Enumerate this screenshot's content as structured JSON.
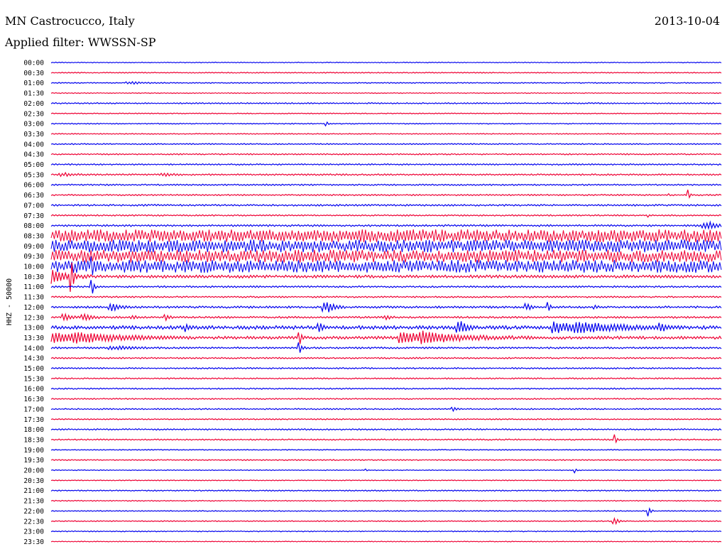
{
  "header": {
    "station": "MN Castrocucco, Italy",
    "date": "2013-10-04",
    "filter": "Applied filter: WWSSN-SP"
  },
  "chart_data": {
    "type": "line",
    "title": "MN Castrocucco, Italy",
    "ylabel": "HHZ - 50000",
    "traces": [
      {
        "label": "00:00",
        "color": "#0000ee",
        "noise": 0.6,
        "events": []
      },
      {
        "label": "00:30",
        "color": "#ee0033",
        "noise": 0.7,
        "events": []
      },
      {
        "label": "01:00",
        "color": "#0000ee",
        "noise": 0.7,
        "events": [
          {
            "t": 0.12,
            "amp": 1.5,
            "dur": 0.03
          }
        ]
      },
      {
        "label": "01:30",
        "color": "#ee0033",
        "noise": 0.6,
        "events": []
      },
      {
        "label": "02:00",
        "color": "#0000ee",
        "noise": 0.9,
        "events": []
      },
      {
        "label": "02:30",
        "color": "#ee0033",
        "noise": 0.6,
        "events": []
      },
      {
        "label": "03:00",
        "color": "#0000ee",
        "noise": 0.7,
        "events": [
          {
            "t": 0.41,
            "amp": 4,
            "dur": 0.004
          }
        ]
      },
      {
        "label": "03:30",
        "color": "#ee0033",
        "noise": 0.7,
        "events": []
      },
      {
        "label": "04:00",
        "color": "#0000ee",
        "noise": 0.8,
        "events": []
      },
      {
        "label": "04:30",
        "color": "#ee0033",
        "noise": 0.9,
        "events": []
      },
      {
        "label": "05:00",
        "color": "#0000ee",
        "noise": 1.0,
        "events": []
      },
      {
        "label": "05:30",
        "color": "#ee0033",
        "noise": 1.1,
        "events": [
          {
            "t": 0.02,
            "amp": 2,
            "dur": 0.03
          },
          {
            "t": 0.17,
            "amp": 2,
            "dur": 0.02
          }
        ]
      },
      {
        "label": "06:00",
        "color": "#0000ee",
        "noise": 1.0,
        "events": []
      },
      {
        "label": "06:30",
        "color": "#ee0033",
        "noise": 1.0,
        "events": [
          {
            "t": 0.95,
            "amp": 10,
            "dur": 0.004
          },
          {
            "t": 0.92,
            "amp": 3,
            "dur": 0.003
          }
        ]
      },
      {
        "label": "07:00",
        "color": "#0000ee",
        "noise": 1.2,
        "events": []
      },
      {
        "label": "07:30",
        "color": "#ee0033",
        "noise": 1.0,
        "events": [
          {
            "t": 0.89,
            "amp": 4,
            "dur": 0.003
          }
        ]
      },
      {
        "label": "08:00",
        "color": "#0000ee",
        "noise": 1.3,
        "events": [
          {
            "t": 0.98,
            "amp": 5,
            "dur": 0.03
          }
        ]
      },
      {
        "label": "08:30",
        "color": "#ee0033",
        "noise": 9,
        "events": []
      },
      {
        "label": "09:00",
        "color": "#0000ee",
        "noise": 9,
        "events": []
      },
      {
        "label": "09:30",
        "color": "#ee0033",
        "noise": 9,
        "events": []
      },
      {
        "label": "10:00",
        "color": "#0000ee",
        "noise": 9,
        "events": [
          {
            "t": 0.06,
            "amp": 22,
            "dur": 0.005
          }
        ]
      },
      {
        "label": "10:30",
        "color": "#ee0033",
        "noise": 2,
        "events": [
          {
            "t": 0.0,
            "amp": 10,
            "dur": 0.04
          },
          {
            "t": 0.03,
            "amp": 25,
            "dur": 0.006
          }
        ]
      },
      {
        "label": "11:00",
        "color": "#0000ee",
        "noise": 1.2,
        "events": [
          {
            "t": 0.06,
            "amp": 20,
            "dur": 0.005
          }
        ]
      },
      {
        "label": "11:30",
        "color": "#ee0033",
        "noise": 1.1,
        "events": []
      },
      {
        "label": "12:00",
        "color": "#0000ee",
        "noise": 1.4,
        "events": [
          {
            "t": 0.09,
            "amp": 6,
            "dur": 0.02
          },
          {
            "t": 0.41,
            "amp": 10,
            "dur": 0.02
          },
          {
            "t": 0.71,
            "amp": 5,
            "dur": 0.01
          },
          {
            "t": 0.74,
            "amp": 12,
            "dur": 0.006
          },
          {
            "t": 0.81,
            "amp": 5,
            "dur": 0.006
          }
        ]
      },
      {
        "label": "12:30",
        "color": "#ee0033",
        "noise": 1.3,
        "events": [
          {
            "t": 0.02,
            "amp": 5,
            "dur": 0.015
          },
          {
            "t": 0.05,
            "amp": 5,
            "dur": 0.02
          },
          {
            "t": 0.17,
            "amp": 5,
            "dur": 0.01
          },
          {
            "t": 0.12,
            "amp": 3,
            "dur": 0.01
          },
          {
            "t": 0.5,
            "amp": 3,
            "dur": 0.01
          }
        ]
      },
      {
        "label": "13:00",
        "color": "#0000ee",
        "noise": 2.5,
        "events": [
          {
            "t": 0.2,
            "amp": 6,
            "dur": 0.005
          },
          {
            "t": 0.4,
            "amp": 6,
            "dur": 0.01
          },
          {
            "t": 0.61,
            "amp": 9,
            "dur": 0.02
          },
          {
            "t": 0.78,
            "amp": 8,
            "dur": 0.11
          },
          {
            "t": 0.91,
            "amp": 6,
            "dur": 0.01
          }
        ]
      },
      {
        "label": "13:30",
        "color": "#ee0033",
        "noise": 2,
        "events": [
          {
            "t": 0.03,
            "amp": 8,
            "dur": 0.12
          },
          {
            "t": 0.37,
            "amp": 14,
            "dur": 0.006
          },
          {
            "t": 0.55,
            "amp": 9,
            "dur": 0.11
          }
        ]
      },
      {
        "label": "14:00",
        "color": "#0000ee",
        "noise": 1.2,
        "events": [
          {
            "t": 0.37,
            "amp": 10,
            "dur": 0.006
          },
          {
            "t": 0.1,
            "amp": 2,
            "dur": 0.05
          }
        ]
      },
      {
        "label": "14:30",
        "color": "#ee0033",
        "noise": 1.0,
        "events": []
      },
      {
        "label": "15:00",
        "color": "#0000ee",
        "noise": 1.0,
        "events": []
      },
      {
        "label": "15:30",
        "color": "#ee0033",
        "noise": 0.9,
        "events": []
      },
      {
        "label": "16:00",
        "color": "#0000ee",
        "noise": 0.9,
        "events": []
      },
      {
        "label": "16:30",
        "color": "#ee0033",
        "noise": 0.9,
        "events": []
      },
      {
        "label": "17:00",
        "color": "#0000ee",
        "noise": 0.9,
        "events": [
          {
            "t": 0.6,
            "amp": 3,
            "dur": 0.01
          }
        ]
      },
      {
        "label": "17:30",
        "color": "#ee0033",
        "noise": 0.8,
        "events": []
      },
      {
        "label": "18:00",
        "color": "#0000ee",
        "noise": 1.0,
        "events": []
      },
      {
        "label": "18:30",
        "color": "#ee0033",
        "noise": 0.9,
        "events": [
          {
            "t": 0.84,
            "amp": 8,
            "dur": 0.006
          }
        ]
      },
      {
        "label": "19:00",
        "color": "#0000ee",
        "noise": 0.6,
        "events": []
      },
      {
        "label": "19:30",
        "color": "#ee0033",
        "noise": 0.8,
        "events": []
      },
      {
        "label": "20:00",
        "color": "#0000ee",
        "noise": 0.6,
        "events": [
          {
            "t": 0.78,
            "amp": 7,
            "dur": 0.004
          },
          {
            "t": 0.47,
            "amp": 2,
            "dur": 0.004
          }
        ]
      },
      {
        "label": "20:30",
        "color": "#ee0033",
        "noise": 0.6,
        "events": []
      },
      {
        "label": "21:00",
        "color": "#0000ee",
        "noise": 0.8,
        "events": []
      },
      {
        "label": "21:30",
        "color": "#ee0033",
        "noise": 0.7,
        "events": []
      },
      {
        "label": "22:00",
        "color": "#0000ee",
        "noise": 0.7,
        "events": [
          {
            "t": 0.89,
            "amp": 11,
            "dur": 0.006
          }
        ]
      },
      {
        "label": "22:30",
        "color": "#ee0033",
        "noise": 0.7,
        "events": [
          {
            "t": 0.84,
            "amp": 5,
            "dur": 0.012
          }
        ]
      },
      {
        "label": "23:00",
        "color": "#0000ee",
        "noise": 0.7,
        "events": []
      },
      {
        "label": "23:30",
        "color": "#ee0033",
        "noise": 0.6,
        "events": []
      }
    ]
  }
}
